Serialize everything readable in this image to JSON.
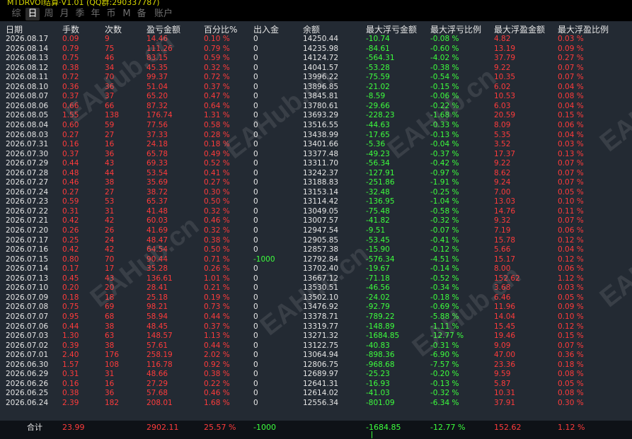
{
  "window": {
    "title": "MTDRVOI结算·V1.01 (QQ群:290337787)"
  },
  "tabs": [
    {
      "label": "综",
      "active": false
    },
    {
      "label": "日",
      "active": true
    },
    {
      "label": "周",
      "active": false
    },
    {
      "label": "月",
      "active": false
    },
    {
      "label": "季",
      "active": false
    },
    {
      "label": "年",
      "active": false
    },
    {
      "label": "币",
      "active": false
    },
    {
      "label": "M",
      "active": false
    },
    {
      "label": "备",
      "active": false
    },
    {
      "label": "账户",
      "active": false
    }
  ],
  "columns": [
    "日期",
    "手数",
    "次数",
    "盈亏金额",
    "百分比%",
    "出入金",
    "余额",
    "最大浮亏金额",
    "最大浮亏比例",
    "最大浮盈金额",
    "最大浮盈比例"
  ],
  "rows": [
    [
      "2026.08.17",
      "0.09",
      "9",
      "14.46",
      "0.10 %",
      "0",
      "14250.44",
      "-10.74",
      "-0.08 %",
      "4.82",
      "0.03 %"
    ],
    [
      "2026.08.14",
      "0.79",
      "75",
      "111.26",
      "0.79 %",
      "0",
      "14235.98",
      "-84.61",
      "-0.60 %",
      "13.19",
      "0.09 %"
    ],
    [
      "2026.08.13",
      "0.75",
      "46",
      "83.15",
      "0.59 %",
      "0",
      "14124.72",
      "-564.31",
      "-4.02 %",
      "37.79",
      "0.27 %"
    ],
    [
      "2026.08.12",
      "0.38",
      "34",
      "45.35",
      "0.32 %",
      "0",
      "14041.57",
      "-53.28",
      "-0.38 %",
      "9.22",
      "0.07 %"
    ],
    [
      "2026.08.11",
      "0.72",
      "70",
      "99.37",
      "0.72 %",
      "0",
      "13996.22",
      "-75.59",
      "-0.54 %",
      "10.35",
      "0.07 %"
    ],
    [
      "2026.08.10",
      "0.36",
      "36",
      "51.04",
      "0.37 %",
      "0",
      "13896.85",
      "-21.02",
      "-0.15 %",
      "6.02",
      "0.04 %"
    ],
    [
      "2026.08.07",
      "0.37",
      "37",
      "65.20",
      "0.47 %",
      "0",
      "13845.81",
      "-8.59",
      "-0.06 %",
      "10.53",
      "0.08 %"
    ],
    [
      "2026.08.06",
      "0.66",
      "66",
      "87.32",
      "0.64 %",
      "0",
      "13780.61",
      "-29.66",
      "-0.22 %",
      "6.03",
      "0.04 %"
    ],
    [
      "2026.08.05",
      "1.55",
      "138",
      "176.74",
      "1.31 %",
      "0",
      "13693.29",
      "-228.23",
      "-1.68 %",
      "20.59",
      "0.15 %"
    ],
    [
      "2026.08.04",
      "0.60",
      "59",
      "77.56",
      "0.58 %",
      "0",
      "13516.55",
      "-44.63",
      "-0.33 %",
      "8.09",
      "0.06 %"
    ],
    [
      "2026.08.03",
      "0.27",
      "27",
      "37.33",
      "0.28 %",
      "0",
      "13438.99",
      "-17.65",
      "-0.13 %",
      "5.35",
      "0.04 %"
    ],
    [
      "2026.07.31",
      "0.16",
      "16",
      "24.18",
      "0.18 %",
      "0",
      "13401.66",
      "-5.36",
      "-0.04 %",
      "3.52",
      "0.03 %"
    ],
    [
      "2026.07.30",
      "0.37",
      "36",
      "65.78",
      "0.49 %",
      "0",
      "13377.48",
      "-49.23",
      "-0.37 %",
      "17.37",
      "0.13 %"
    ],
    [
      "2026.07.29",
      "0.44",
      "43",
      "69.33",
      "0.52 %",
      "0",
      "13311.70",
      "-56.34",
      "-0.42 %",
      "9.22",
      "0.07 %"
    ],
    [
      "2026.07.28",
      "0.48",
      "44",
      "53.54",
      "0.41 %",
      "0",
      "13242.37",
      "-127.91",
      "-0.97 %",
      "8.62",
      "0.07 %"
    ],
    [
      "2026.07.27",
      "0.46",
      "38",
      "35.69",
      "0.27 %",
      "0",
      "13188.83",
      "-251.86",
      "-1.91 %",
      "9.24",
      "0.07 %"
    ],
    [
      "2026.07.24",
      "0.27",
      "27",
      "38.72",
      "0.30 %",
      "0",
      "13153.14",
      "-32.48",
      "-0.25 %",
      "7.00",
      "0.05 %"
    ],
    [
      "2026.07.23",
      "0.59",
      "53",
      "65.37",
      "0.50 %",
      "0",
      "13114.42",
      "-136.95",
      "-1.04 %",
      "13.03",
      "0.10 %"
    ],
    [
      "2026.07.22",
      "0.31",
      "31",
      "41.48",
      "0.32 %",
      "0",
      "13049.05",
      "-75.48",
      "-0.58 %",
      "14.76",
      "0.11 %"
    ],
    [
      "2026.07.21",
      "0.42",
      "42",
      "60.03",
      "0.46 %",
      "0",
      "13007.57",
      "-41.82",
      "-0.32 %",
      "9.32",
      "0.07 %"
    ],
    [
      "2026.07.20",
      "0.26",
      "26",
      "41.69",
      "0.32 %",
      "0",
      "12947.54",
      "-9.51",
      "-0.07 %",
      "7.19",
      "0.06 %"
    ],
    [
      "2026.07.17",
      "0.25",
      "24",
      "48.47",
      "0.38 %",
      "0",
      "12905.85",
      "-53.45",
      "-0.41 %",
      "15.78",
      "0.12 %"
    ],
    [
      "2026.07.16",
      "0.42",
      "42",
      "64.54",
      "0.50 %",
      "0",
      "12857.38",
      "-15.90",
      "-0.12 %",
      "5.66",
      "0.04 %"
    ],
    [
      "2026.07.15",
      "0.80",
      "70",
      "90.44",
      "0.71 %",
      "-1000",
      "12792.84",
      "-576.34",
      "-4.51 %",
      "15.17",
      "0.12 %"
    ],
    [
      "2026.07.14",
      "0.17",
      "17",
      "35.28",
      "0.26 %",
      "0",
      "13702.40",
      "-19.67",
      "-0.14 %",
      "8.00",
      "0.06 %"
    ],
    [
      "2026.07.13",
      "0.45",
      "43",
      "136.61",
      "1.01 %",
      "0",
      "13667.12",
      "-71.18",
      "-0.52 %",
      "152.62",
      "1.12 %"
    ],
    [
      "2026.07.10",
      "0.20",
      "20",
      "28.41",
      "0.21 %",
      "0",
      "13530.51",
      "-46.56",
      "-0.34 %",
      "3.68",
      "0.03 %"
    ],
    [
      "2026.07.09",
      "0.18",
      "18",
      "25.18",
      "0.19 %",
      "0",
      "13502.10",
      "-24.02",
      "-0.18 %",
      "6.46",
      "0.05 %"
    ],
    [
      "2026.07.08",
      "0.75",
      "69",
      "98.21",
      "0.73 %",
      "0",
      "13476.92",
      "-92.79",
      "-0.69 %",
      "11.96",
      "0.09 %"
    ],
    [
      "2026.07.07",
      "0.95",
      "68",
      "58.94",
      "0.44 %",
      "0",
      "13378.71",
      "-789.22",
      "-5.88 %",
      "14.04",
      "0.10 %"
    ],
    [
      "2026.07.06",
      "0.44",
      "38",
      "48.45",
      "0.37 %",
      "0",
      "13319.77",
      "-148.89",
      "-1.11 %",
      "15.45",
      "0.12 %"
    ],
    [
      "2026.07.03",
      "1.30",
      "63",
      "148.57",
      "1.13 %",
      "0",
      "13271.32",
      "-1684.85",
      "-12.77 %",
      "19.46",
      "0.15 %"
    ],
    [
      "2026.07.02",
      "0.39",
      "38",
      "57.61",
      "0.44 %",
      "0",
      "13122.75",
      "-40.83",
      "-0.31 %",
      "9.09",
      "0.07 %"
    ],
    [
      "2026.07.01",
      "2.40",
      "176",
      "258.19",
      "2.02 %",
      "0",
      "13064.94",
      "-898.36",
      "-6.90 %",
      "47.00",
      "0.36 %"
    ],
    [
      "2026.06.30",
      "1.57",
      "108",
      "116.78",
      "0.92 %",
      "0",
      "12806.75",
      "-968.68",
      "-7.57 %",
      "23.36",
      "0.18 %"
    ],
    [
      "2026.06.29",
      "0.31",
      "31",
      "48.66",
      "0.38 %",
      "0",
      "12689.97",
      "-25.23",
      "-0.20 %",
      "9.59",
      "0.08 %"
    ],
    [
      "2026.06.26",
      "0.16",
      "16",
      "27.29",
      "0.22 %",
      "0",
      "12641.31",
      "-16.93",
      "-0.13 %",
      "5.87",
      "0.05 %"
    ],
    [
      "2026.06.25",
      "0.38",
      "36",
      "57.68",
      "0.46 %",
      "0",
      "12614.02",
      "-41.03",
      "-0.32 %",
      "10.31",
      "0.08 %"
    ],
    [
      "2026.06.24",
      "2.39",
      "182",
      "208.01",
      "1.68 %",
      "0",
      "12556.34",
      "-801.09",
      "-6.34 %",
      "37.91",
      "0.30 %"
    ]
  ],
  "totals": {
    "label": "合计",
    "lots": "23.99",
    "count": "",
    "pnl": "2902.11",
    "pct": "25.57 %",
    "flow": "-1000",
    "balance": "",
    "max_float_loss": "-1684.85",
    "max_float_loss_pct": "-12.77 %",
    "max_float_profit": "152.62",
    "max_float_profit_pct": "1.12 %"
  },
  "watermark": "EAHub.cn",
  "colors": {
    "background": "#232a33",
    "positive": "#ff3b3b",
    "negative": "#3dff3d",
    "text": "#e6e6e6"
  }
}
